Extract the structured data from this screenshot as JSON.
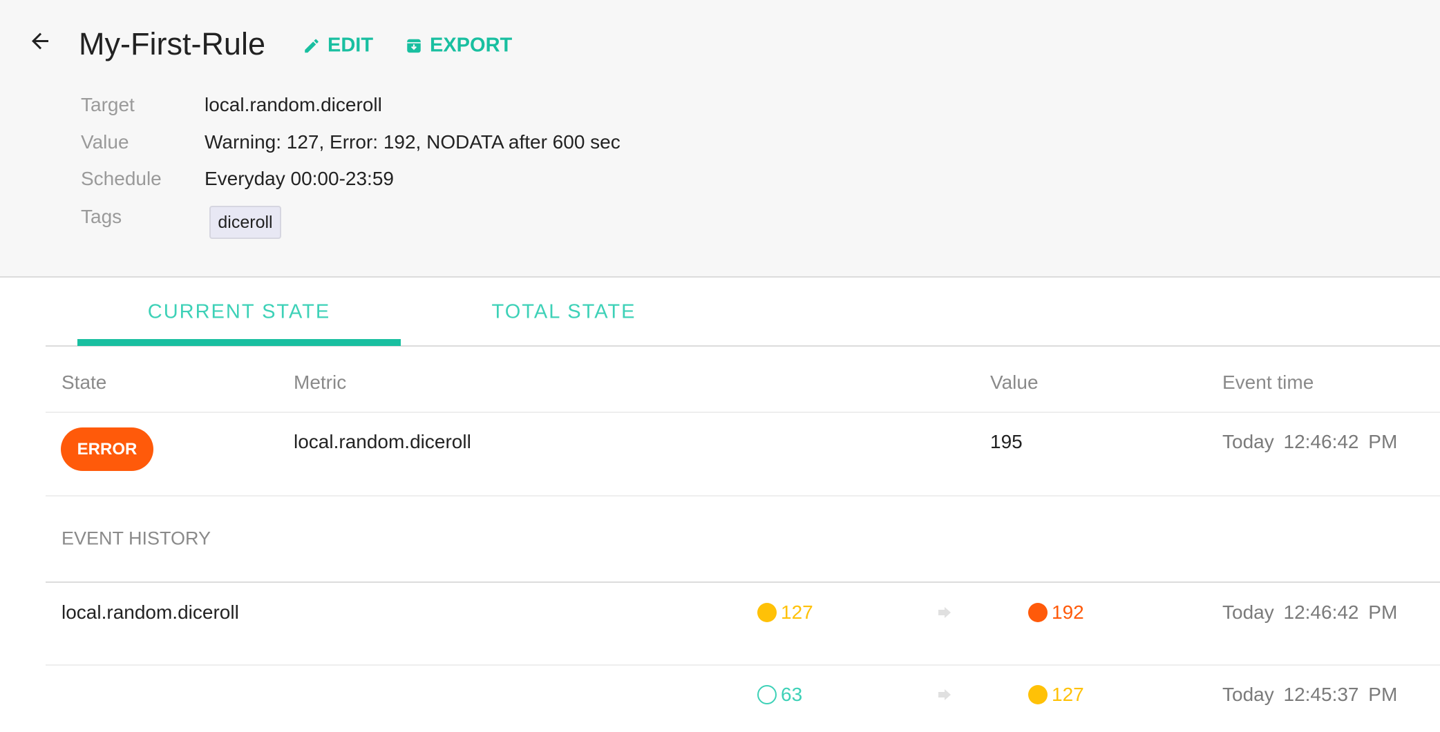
{
  "header": {
    "title": "My-First-Rule",
    "edit_label": "EDIT",
    "export_label": "EXPORT",
    "fields": [
      {
        "label": "Target",
        "value": "local.random.diceroll"
      },
      {
        "label": "Value",
        "value": "Warning: 127, Error: 192, NODATA after 600 sec"
      },
      {
        "label": "Schedule",
        "value": "Everyday 00:00-23:59"
      },
      {
        "label": "Tags",
        "tags": [
          "diceroll"
        ]
      }
    ]
  },
  "tabs": [
    {
      "label": "CURRENT STATE",
      "active": true
    },
    {
      "label": "TOTAL STATE",
      "active": false
    }
  ],
  "table": {
    "columns": [
      "State",
      "Metric",
      "Value",
      "Event time"
    ],
    "rows": [
      {
        "state": "ERROR",
        "metric": "local.random.diceroll",
        "value": "195",
        "day": "Today",
        "time": "12:46:42 PM"
      }
    ]
  },
  "history": {
    "title": "EVENT HISTORY",
    "rows": [
      {
        "metric": "local.random.diceroll",
        "from_value": "127",
        "from_state": "warning",
        "to_value": "192",
        "to_state": "error",
        "day": "Today",
        "time": "12:46:42 PM"
      },
      {
        "metric": "",
        "from_value": "63",
        "from_state": "ok",
        "to_value": "127",
        "to_state": "warning",
        "day": "Today",
        "time": "12:45:37 PM"
      }
    ]
  },
  "colors": {
    "accent": "#19bfa0",
    "error": "#ff5a0a",
    "warning": "#ffc107",
    "ok": "#3dd1b7"
  }
}
